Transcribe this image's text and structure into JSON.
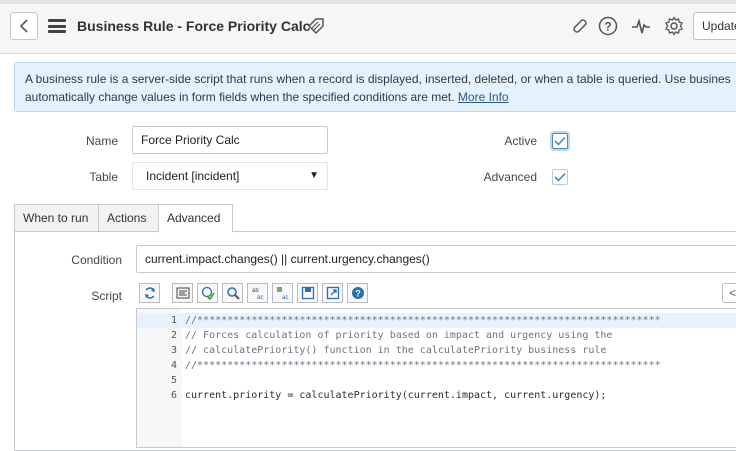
{
  "header": {
    "title": "Business Rule - Force Priority Calc",
    "update_label": "Update",
    "icons": [
      "back-arrow-icon",
      "menu-icon",
      "tag-icon",
      "paperclip-icon",
      "help-icon",
      "activity-icon",
      "gear-icon"
    ]
  },
  "banner": {
    "line1": "A business rule is a server-side script that runs when a record is displayed, inserted, deleted, or when a table is queried. Use busines",
    "line2": "automatically change values in form fields when the specified conditions are met.",
    "link": "More Info"
  },
  "form": {
    "name_label": "Name",
    "name_value": "Force Priority Calc",
    "table_label": "Table",
    "table_value": "Incident [incident]",
    "active_label": "Active",
    "active_checked": true,
    "advanced_label": "Advanced",
    "advanced_checked": true
  },
  "tabs": [
    {
      "label": "When to run",
      "active": false
    },
    {
      "label": "Actions",
      "active": false
    },
    {
      "label": "Advanced",
      "active": true
    }
  ],
  "advanced": {
    "condition_label": "Condition",
    "condition_value": "current.impact.changes() || current.urgency.changes()",
    "script_label": "Script",
    "toolbar_icons": [
      "toggle-syntax-icon",
      "format-code-icon",
      "check-syntax-icon",
      "search-icon",
      "replace-icon",
      "replace-all-icon",
      "save-icon",
      "fullscreen-icon",
      "help-icon"
    ],
    "lines": [
      {
        "num": "1",
        "text": "//*****************************************************************************",
        "comment": true
      },
      {
        "num": "2",
        "text": "// Forces calculation of priority based on impact and urgency using the",
        "comment": true
      },
      {
        "num": "3",
        "text": "// calculatePriority() function in the calculatePriority business rule",
        "comment": true
      },
      {
        "num": "4",
        "text": "//*****************************************************************************",
        "comment": true
      },
      {
        "num": "5",
        "text": "",
        "comment": false
      },
      {
        "num": "6",
        "text": "current.priority = calculatePriority(current.impact, current.urgency);",
        "comment": false
      }
    ]
  },
  "colors": {
    "accent": "#2d5a8c",
    "banner_bg": "#e5f1fb",
    "checkbox_check": "#4c88b8"
  }
}
